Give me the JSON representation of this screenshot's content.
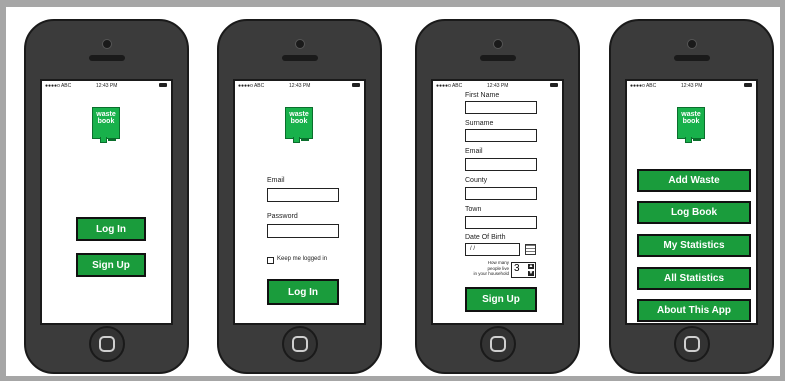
{
  "status": {
    "carrier": "●●●●o ABC",
    "time": "12:43 PM"
  },
  "logo": {
    "line1": "waste",
    "line2": "book"
  },
  "screen1": {
    "login_label": "Log In",
    "signup_label": "Sign Up"
  },
  "screen2": {
    "email_label": "Email",
    "password_label": "Password",
    "keep_label": "Keep me logged in",
    "login_label": "Log In"
  },
  "screen3": {
    "first_name_label": "First Name",
    "surname_label": "Surname",
    "email_label": "Email",
    "county_label": "County",
    "town_label": "Town",
    "dob_label": "Date Of Birth",
    "dob_value": "/  /",
    "household_line1": "How many",
    "household_line2": "people live",
    "household_line3": "in your household",
    "household_value": "3",
    "signup_label": "Sign Up"
  },
  "screen4": {
    "menu": [
      "Add Waste",
      "Log Book",
      "My Statistics",
      "All Statistics",
      "About This App"
    ]
  },
  "colors": {
    "accent": "#1a9c3c",
    "frame": "#3b3b3b"
  }
}
